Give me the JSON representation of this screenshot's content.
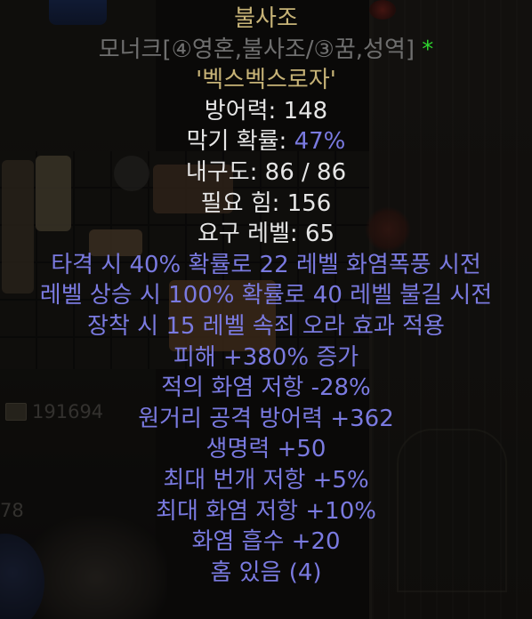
{
  "background": {
    "gold_amount": "191694",
    "left_number": "78"
  },
  "tooltip": {
    "item_name": "불사조",
    "item_base": "모너크[④영혼,불사조/③꿈,성역]",
    "ethereal_mark": "*",
    "runes": "'벡스벡스로자'",
    "defense_label": "방어력: ",
    "defense_value": "148",
    "block_label": "막기 확률: ",
    "block_value": "47%",
    "durability": "내구도: 86 / 86",
    "req_str": "필요 힘: 156",
    "req_level": "요구 레벨: 65",
    "magic_properties": [
      "타격 시 40% 확률로 22 레벨 화염폭풍 시전",
      "레벨 상승 시 100% 확률로 40 레벨 불길 시전",
      "장착 시 15 레벨 속죄 오라 효과 적용",
      "피해 +380% 증가",
      "적의 화염 저항 -28%",
      "원거리 공격 방어력 +362",
      "생명력 +50",
      "최대 번개 저항 +5%",
      "최대 화염 저항 +10%",
      "화염 흡수 +20",
      "홈 있음 (4)"
    ]
  },
  "colors": {
    "unique_gold": "#c7b377",
    "base_gray": "#6f6f6f",
    "stat_white": "#e6e6e6",
    "magic_blue": "#7a7ae0",
    "ethereal_green": "#2ed52e"
  },
  "icons": [
    "shield-item-icon",
    "gold-pile-icon",
    "ring-icon",
    "amulet-icon"
  ]
}
